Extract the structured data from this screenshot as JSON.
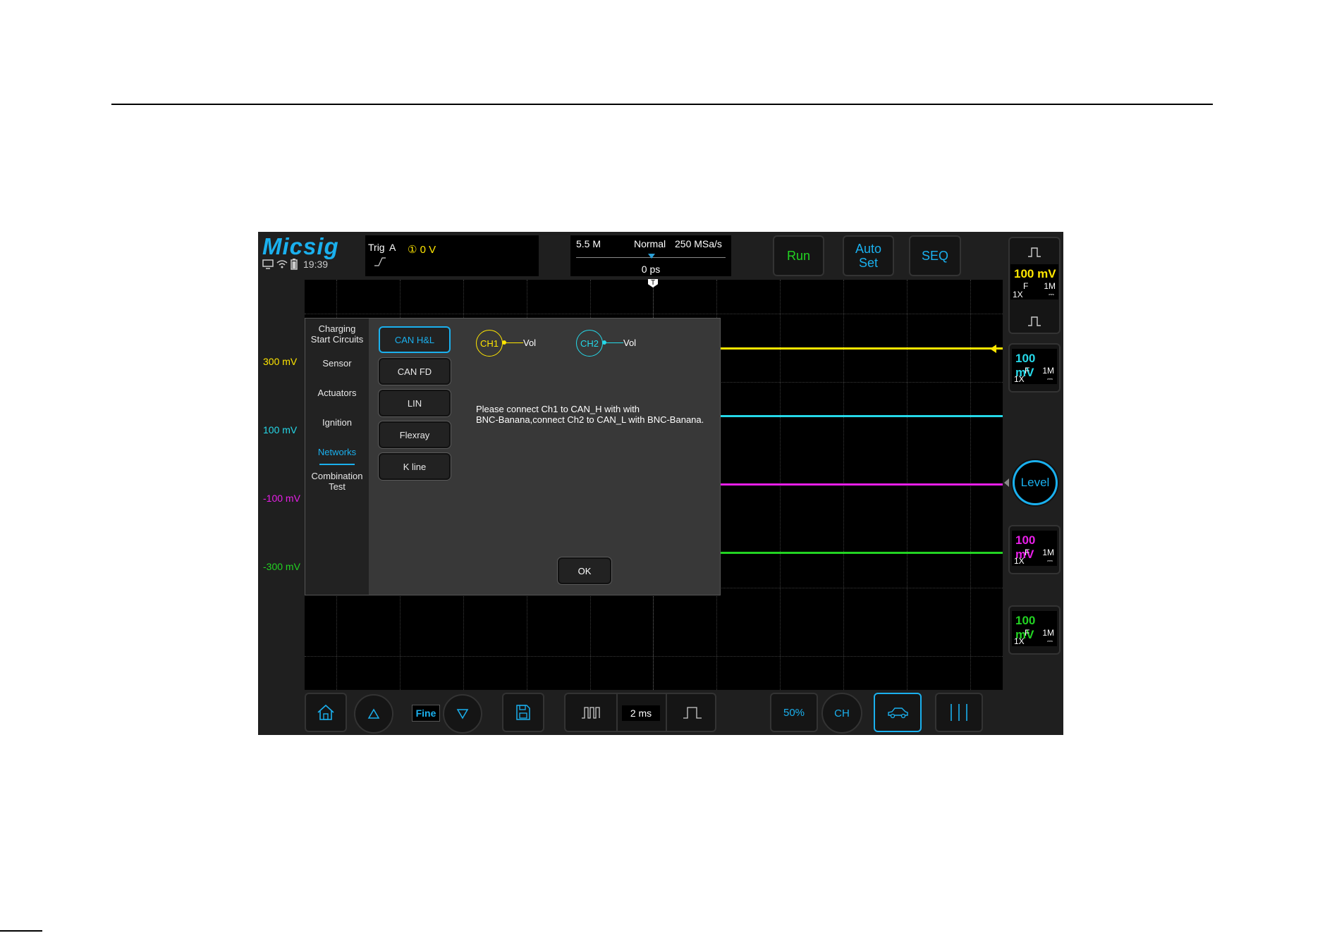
{
  "app": {
    "brand": "Micsig",
    "time": "19:39"
  },
  "trigger": {
    "label": "Trig",
    "source": "A",
    "level": "① 0 V"
  },
  "timebase_info": {
    "memory": "5.5 M",
    "mode": "Normal",
    "sample_rate": "250 MSa/s",
    "position": "0 ps"
  },
  "top_buttons": {
    "run": "Run",
    "auto_line1": "Auto",
    "auto_line2": "Set",
    "seq": "SEQ"
  },
  "y_labels": [
    {
      "text": "300 mV",
      "color": "#ffe600"
    },
    {
      "text": "100 mV",
      "color": "#25d8e8"
    },
    {
      "text": "-100 mV",
      "color": "#e81ee8"
    },
    {
      "text": "-300 mV",
      "color": "#22d322"
    }
  ],
  "channels": [
    {
      "scale": "100 mV",
      "coupling": "F",
      "impedance": "1M",
      "probe": "1X",
      "color": "#ffe600"
    },
    {
      "scale": "100 mV",
      "coupling": "F",
      "impedance": "1M",
      "probe": "1X",
      "color": "#25d8e8"
    },
    {
      "scale": "100 mV",
      "coupling": "F",
      "impedance": "1M",
      "probe": "1X",
      "color": "#e81ee8"
    },
    {
      "scale": "100 mV",
      "coupling": "F",
      "impedance": "1M",
      "probe": "1X",
      "color": "#22d322"
    }
  ],
  "level_button": "Level",
  "bottom": {
    "fine": "Fine",
    "timebase": "2 ms",
    "half": "50%",
    "ch_label": "CH"
  },
  "dialog": {
    "categories": [
      {
        "label": "Charging\nStart Circuits"
      },
      {
        "label": "Sensor"
      },
      {
        "label": "Actuators"
      },
      {
        "label": "Ignition"
      },
      {
        "label": "Networks",
        "active": true
      },
      {
        "label": "Combination\nTest"
      }
    ],
    "subitems": [
      {
        "label": "CAN H&L",
        "active": true
      },
      {
        "label": "CAN FD"
      },
      {
        "label": "LIN"
      },
      {
        "label": "Flexray"
      },
      {
        "label": "K line"
      }
    ],
    "ch1": {
      "label": "CH1",
      "signal": "Vol",
      "color": "#ffe600"
    },
    "ch2": {
      "label": "CH2",
      "signal": "Vol",
      "color": "#25d8e8"
    },
    "instruction_line1": "Please connect Ch1 to CAN_H with with",
    "instruction_line2": "BNC-Banana,connect Ch2 to CAN_L with BNC-Banana.",
    "ok": "OK"
  },
  "icons": [
    "monitor-icon",
    "wifi-icon",
    "battery-icon",
    "rising-edge-icon",
    "home-icon",
    "up-triangle-icon",
    "down-triangle-icon",
    "save-icon",
    "wide-pulse-icon",
    "narrow-pulse-icon",
    "car-icon",
    "cursor-lines-icon"
  ]
}
